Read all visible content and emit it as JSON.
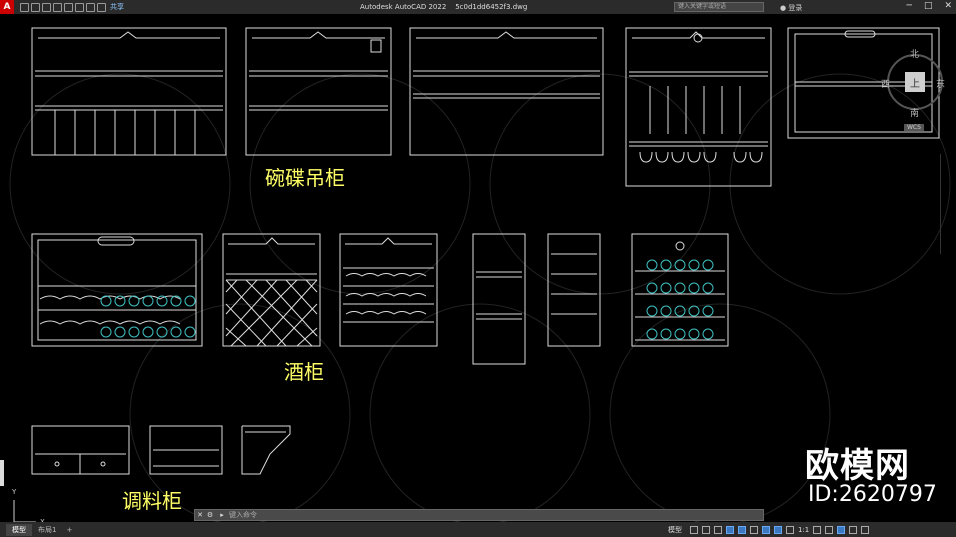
{
  "titlebar": {
    "logo": "A",
    "share_label": "共享",
    "app_title": "Autodesk AutoCAD 2022",
    "file_name": "5c0d1dd6452f3.dwg",
    "search_placeholder": "键入关键字或短语",
    "login_label": "登录",
    "window_controls": [
      "─",
      "□",
      "✕"
    ]
  },
  "drawing": {
    "labels": {
      "dish_cabinet": "碗碟吊柜",
      "wine_cabinet": "酒柜",
      "spice_cabinet": "调料柜"
    },
    "brand_watermark": "欧模网",
    "id_watermark": "ID:2620797"
  },
  "viewcube": {
    "north": "北",
    "south": "南",
    "east": "东",
    "west": "西",
    "top_face": "上",
    "wcs": "WCS"
  },
  "ucs": {
    "x": "X",
    "y": "Y"
  },
  "commandline": {
    "close": "✕",
    "placeholder": "键入命令"
  },
  "statusbar": {
    "tabs": [
      "模型",
      "布局1"
    ],
    "add_tab": "+",
    "model_label": "模型",
    "scale": "1:1"
  },
  "colors": {
    "background": "#000000",
    "lines": "#dddddd",
    "label": "#ffff66",
    "bottle": "#40c0c0",
    "accent": "#3a78c2"
  }
}
